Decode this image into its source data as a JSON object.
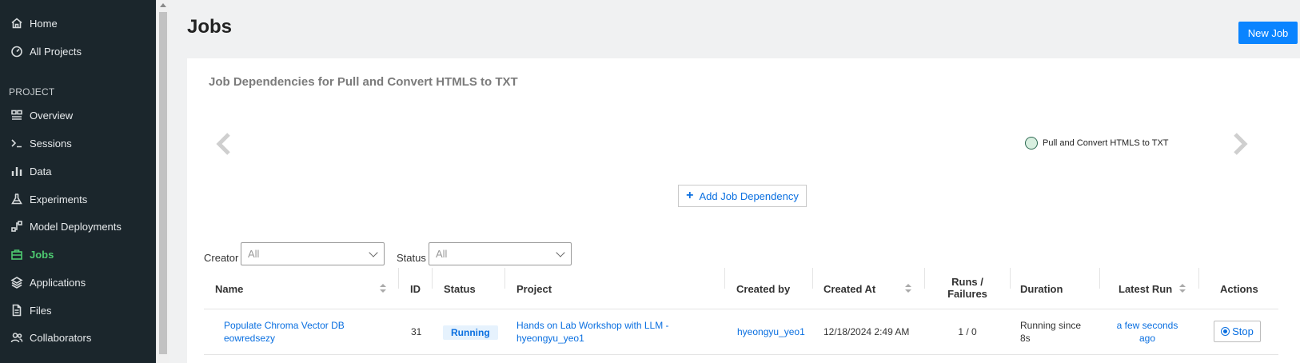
{
  "nav": {
    "home": "Home",
    "all_projects": "All Projects",
    "section": "PROJECT",
    "overview": "Overview",
    "sessions": "Sessions",
    "data": "Data",
    "experiments": "Experiments",
    "model_deployments": "Model Deployments",
    "jobs": "Jobs",
    "applications": "Applications",
    "files": "Files",
    "collaborators": "Collaborators"
  },
  "page": {
    "title": "Jobs",
    "new_job_label": "New Job"
  },
  "dependencies": {
    "title": "Job Dependencies for Pull and Convert HTMLS to TXT",
    "node_label": "Pull and Convert HTMLS to TXT",
    "add_label": "Add Job Dependency"
  },
  "filters": {
    "creator_label": "Creator",
    "creator_value": "All",
    "status_label": "Status",
    "status_value": "All"
  },
  "table": {
    "columns": {
      "name": "Name",
      "id": "ID",
      "status": "Status",
      "project": "Project",
      "created_by": "Created by",
      "created_at": "Created At",
      "runs_failures_1": "Runs /",
      "runs_failures_2": "Failures",
      "duration": "Duration",
      "latest_run": "Latest Run",
      "actions": "Actions"
    },
    "rows": [
      {
        "name_line1": "Populate Chroma Vector DB",
        "name_line2": "eowredsezy",
        "id": "31",
        "status": "Running",
        "project_line1": "Hands on Lab Workshop with LLM -",
        "project_line2": "hyeongyu_yeo1",
        "created_by": "hyeongyu_yeo1",
        "created_at": "12/18/2024 2:49 AM",
        "runs_failures": "1 / 0",
        "duration_line1": "Running since",
        "duration_line2": "8s",
        "latest_run_line1": "a few seconds",
        "latest_run_line2": "ago",
        "action_label": "Stop"
      }
    ]
  },
  "colors": {
    "sidebar_bg": "#1b262c",
    "active_nav": "#4ecb71",
    "primary": "#0a84ff",
    "link": "#0a6fe0"
  }
}
